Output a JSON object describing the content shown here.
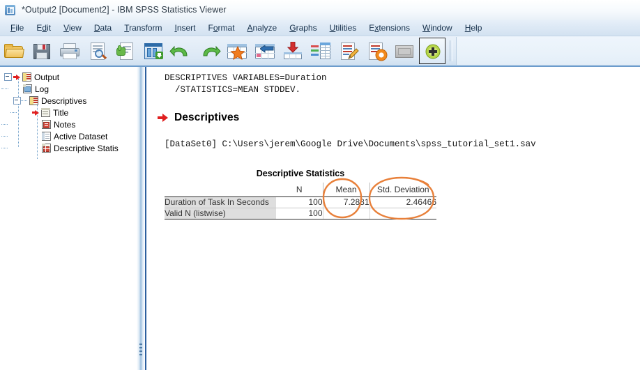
{
  "window": {
    "title": "*Output2 [Document2] - IBM SPSS Statistics Viewer",
    "app_icon": "spss-viewer-icon"
  },
  "menubar": {
    "items": [
      {
        "label": "File",
        "mnemonic": "F"
      },
      {
        "label": "Edit",
        "mnemonic": "E"
      },
      {
        "label": "View",
        "mnemonic": "V"
      },
      {
        "label": "Data",
        "mnemonic": "D"
      },
      {
        "label": "Transform",
        "mnemonic": "T"
      },
      {
        "label": "Insert",
        "mnemonic": "I"
      },
      {
        "label": "Format",
        "mnemonic": "o"
      },
      {
        "label": "Analyze",
        "mnemonic": "A"
      },
      {
        "label": "Graphs",
        "mnemonic": "G"
      },
      {
        "label": "Utilities",
        "mnemonic": "U"
      },
      {
        "label": "Extensions",
        "mnemonic": "x"
      },
      {
        "label": "Window",
        "mnemonic": "W"
      },
      {
        "label": "Help",
        "mnemonic": "H"
      }
    ]
  },
  "toolbar": {
    "buttons": [
      {
        "name": "open-file-icon",
        "tooltip": "Open data document"
      },
      {
        "name": "save-icon",
        "tooltip": "Save this document"
      },
      {
        "name": "print-icon",
        "tooltip": "Print"
      },
      {
        "name": "print-preview-icon",
        "tooltip": "Print preview"
      },
      {
        "name": "recall-dialog-icon",
        "tooltip": "Recall recently used dialogs"
      },
      {
        "name": "export-icon",
        "tooltip": "Export"
      },
      {
        "name": "undo-icon",
        "tooltip": "Undo"
      },
      {
        "name": "redo-icon",
        "tooltip": "Redo"
      },
      {
        "name": "goto-data-icon",
        "tooltip": "Go to data"
      },
      {
        "name": "goto-case-icon",
        "tooltip": "Go to case"
      },
      {
        "name": "insert-footnote-icon",
        "tooltip": "Insert"
      },
      {
        "name": "select-variable-icon",
        "tooltip": "Variables"
      },
      {
        "name": "show-syntax-icon",
        "tooltip": "Show syntax"
      },
      {
        "name": "run-script-icon",
        "tooltip": "Run script"
      },
      {
        "name": "hide-show-icon",
        "tooltip": "Hide/Show"
      },
      {
        "name": "insert-object-icon",
        "tooltip": "Insert new output",
        "selected": true
      }
    ]
  },
  "tree": {
    "root": {
      "label": "Output",
      "icon": "output-book-icon",
      "expanded": true,
      "marked": true
    },
    "children": [
      {
        "label": "Log",
        "icon": "log-icon",
        "depth": 1
      },
      {
        "label": "Descriptives",
        "icon": "output-book-icon",
        "depth": 1,
        "expanded": true
      },
      {
        "label": "Title",
        "icon": "title-icon",
        "depth": 2,
        "marked": true
      },
      {
        "label": "Notes",
        "icon": "notes-icon",
        "depth": 2
      },
      {
        "label": "Active Dataset",
        "icon": "dataset-icon",
        "depth": 2
      },
      {
        "label": "Descriptive Statis",
        "icon": "table-icon",
        "depth": 2
      }
    ]
  },
  "output": {
    "syntax": "DESCRIPTIVES VARIABLES=Duration\n  /STATISTICS=MEAN STDDEV.",
    "heading": "Descriptives",
    "dataset_line": "[DataSet0] C:\\Users\\jerem\\Google Drive\\Documents\\spss_tutorial_set1.sav",
    "table": {
      "title": "Descriptive Statistics",
      "columns": [
        "",
        "N",
        "Mean",
        "Std. Deviation"
      ],
      "rows": [
        {
          "label": "Duration of Task In Seconds",
          "N": "100",
          "Mean": "7.2881",
          "StdDev": "2.46466"
        },
        {
          "label": "Valid N (listwise)",
          "N": "100",
          "Mean": "",
          "StdDev": ""
        }
      ]
    },
    "annotations": [
      {
        "name": "mean-highlight-ellipse",
        "color": "#E8803A",
        "target": "Mean column"
      },
      {
        "name": "stddev-highlight-ellipse",
        "color": "#E8803A",
        "target": "Std. Deviation column"
      }
    ]
  },
  "colors": {
    "annotation_orange": "#E8803A",
    "marker_red": "#E02020",
    "pane_border_blue": "#2C5F9E",
    "row_label_gray": "#DEDEDE"
  }
}
